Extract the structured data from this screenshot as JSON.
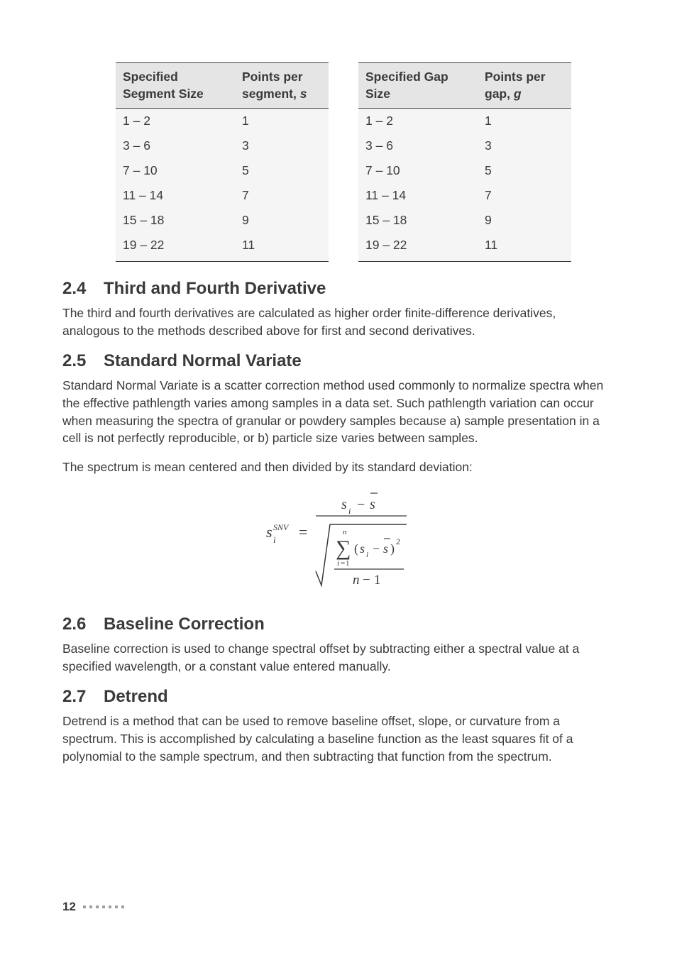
{
  "table1": {
    "head_col1": "Specified Segment Size",
    "head_col2_a": "Points per",
    "head_col2_b": "segment, ",
    "head_col2_c": "s",
    "rows": [
      {
        "c1": "1 – 2",
        "c2": "1"
      },
      {
        "c1": "3 – 6",
        "c2": "3"
      },
      {
        "c1": "7 – 10",
        "c2": "5"
      },
      {
        "c1": "11 – 14",
        "c2": "7"
      },
      {
        "c1": "15 – 18",
        "c2": "9"
      },
      {
        "c1": "19 – 22",
        "c2": "11"
      }
    ]
  },
  "table2": {
    "head_col1": "Specified Gap Size",
    "head_col2_a": "Points per",
    "head_col2_b": "gap, ",
    "head_col2_c": "g",
    "rows": [
      {
        "c1": "1 – 2",
        "c2": "1"
      },
      {
        "c1": "3 – 6",
        "c2": "3"
      },
      {
        "c1": "7 – 10",
        "c2": "5"
      },
      {
        "c1": "11 – 14",
        "c2": "7"
      },
      {
        "c1": "15 – 18",
        "c2": "9"
      },
      {
        "c1": "19 – 22",
        "c2": "11"
      }
    ]
  },
  "s24": {
    "num": "2.4",
    "title": "Third and Fourth Derivative",
    "p1": "The third and fourth derivatives are calculated as higher order finite-difference derivatives, analogous to the methods described above for first and second derivatives."
  },
  "s25": {
    "num": "2.5",
    "title": "Standard Normal Variate",
    "p1": "Standard Normal Variate is a scatter correction method used commonly to normalize spectra when the effective pathlength varies among samples in a data set. Such pathlength variation can occur when measuring the spectra of granular or powdery samples because a) sample presentation in a cell is not perfectly reproducible, or b) particle size varies between samples.",
    "p2": "The spectrum is mean centered and then divided by its standard deviation:"
  },
  "s26": {
    "num": "2.6",
    "title": "Baseline Correction",
    "p1": "Baseline correction is used to change spectral offset by subtracting either a spectral value at a specified wavelength, or a constant value entered manually."
  },
  "s27": {
    "num": "2.7",
    "title": "Detrend",
    "p1": "Detrend is a method that can be used to remove baseline offset, slope, or curvature from a spectrum. This is accomplished by calculating a baseline function as the least squares fit of a polynomial to the sample spectrum, and then subtracting that function from the spectrum."
  },
  "eq": {
    "lhs_s": "s",
    "lhs_i": "i",
    "lhs_sup": "SNV",
    "num_s": "s",
    "num_i": "i",
    "num_sbar": "s",
    "sum": "∑",
    "sum_low_i": "i",
    "sum_low_eq": "=",
    "sum_low_1": "1",
    "sum_hi": "n",
    "den_s": "s",
    "den_i": "i",
    "den_sbar": "s",
    "den_sq": "2",
    "nminus1_n": "n",
    "nminus1_m": "−",
    "nminus1_1": "1",
    "eq_sign": "=",
    "minus": "−"
  },
  "footer": {
    "page": "12"
  }
}
